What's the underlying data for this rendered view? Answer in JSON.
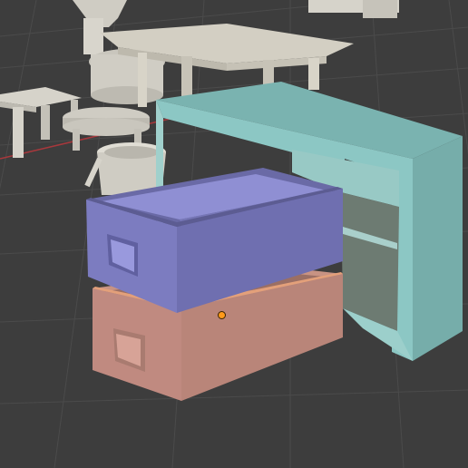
{
  "viewport": {
    "mode": "3d-viewport-solid-shading",
    "background_color": "#3d3d3d",
    "grid_color": "#4a4a4a",
    "x_axis_color": "#a8383c"
  },
  "objects": [
    {
      "name": "cabinet",
      "color": "#83bfbf",
      "selected": false
    },
    {
      "name": "drawer-top",
      "color": "#7b7bbd",
      "selected": false
    },
    {
      "name": "drawer-bottom",
      "color": "#c08a80",
      "selected": true
    },
    {
      "name": "table",
      "color": "#d3cfc3",
      "selected": false
    },
    {
      "name": "stool",
      "color": "#d6d3ca",
      "selected": false
    },
    {
      "name": "round-stool",
      "color": "#d6d3ca",
      "selected": false
    },
    {
      "name": "bucket",
      "color": "#d6d3ca",
      "selected": false
    },
    {
      "name": "lamp-tower",
      "color": "#d6d3ca",
      "selected": false
    }
  ],
  "selection": {
    "origin_marker_color": "#ff9a1a"
  }
}
